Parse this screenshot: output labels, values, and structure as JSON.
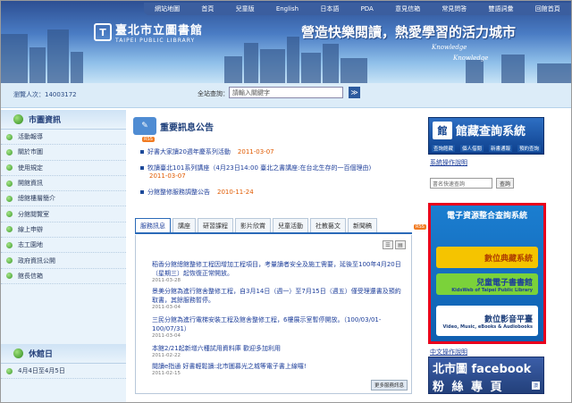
{
  "colors": {
    "header_top": "#2d4f93",
    "accent": "#1d3e9a",
    "date": "#e05a00",
    "ebox_border": "#e8001c"
  },
  "topnav": [
    "網站地圖",
    "首頁",
    "兒童版",
    "English",
    "日本語",
    "PDA",
    "意見信箱",
    "常見問答",
    "雙語詞彙",
    "回館首頁"
  ],
  "logo": {
    "title": "臺北市立圖書館",
    "subtitle": "TAIPEI PUBLIC LIBRARY",
    "mark": "T"
  },
  "slogan": "營造快樂閱讀，熱愛學習的活力城市",
  "keywords": [
    "Knowledge",
    "Knowledge"
  ],
  "infobar": {
    "visits": "瀏覽人次：14003172",
    "search_label": "全站查詢：",
    "search_placeholder": "請輸入關鍵字",
    "search_button": "≫"
  },
  "sidebar": {
    "title": "市圖資訊",
    "items": [
      "活動報導",
      "關於市圖",
      "使用規定",
      "開館資訊",
      "總館樓層簡介",
      "分館閱覽室",
      "線上申辦",
      "志工園地",
      "政府資訊公開",
      "館長信箱"
    ]
  },
  "holiday": {
    "title": "休館日",
    "items": [
      "4月4日至4月5日"
    ]
  },
  "news_section": {
    "title": "重要訊息公告",
    "icon": "news-icon",
    "rss": "RSS",
    "items": [
      {
        "text": "好書大家讀20週年慶系列活動",
        "date": "2011-03-07"
      },
      {
        "text": "牧讀臺北101系列講座（4月23日14:00 臺北之書講座:在台北生存的一百個理由)",
        "date": "2011-03-07"
      },
      {
        "text": "分館整修服務調整公告",
        "date": "2010-11-24"
      }
    ]
  },
  "tabs": [
    "服務訊息",
    "講座",
    "研習課程",
    "影片欣賞",
    "兒童活動",
    "社教藝文",
    "新聞稿"
  ],
  "rss2": "RSS",
  "posts": [
    {
      "title": "稻香分館總館整修工程因增加工程項目，考量讀者安全及施工需要，延後至100年4月20日（星期三）起恢復正常開放。",
      "date": "2011-03-28"
    },
    {
      "title": "景美分館為進行館舍整修工程，自3月14日（週一）至7月15日（週五）僅受理還書及預約取書，其餘服務暫停。",
      "date": "2011-03-04"
    },
    {
      "title": "三民分館為進行電梯安裝工程及館舍整修工程，6樓展示室暫停開放。（100/03/01-100/07/31）",
      "date": "2011-03-04"
    },
    {
      "title": "本館2/21起新增六種試用資料庫 歡迎多加利用",
      "date": "2011-02-22"
    },
    {
      "title": "閱讀e指通 好書輕鬆讀:北市圖募光之城等電子書上線囉!",
      "date": "2011-02-15"
    }
  ],
  "more_button": "更多服務訊息",
  "view_icons": [
    "☰",
    "▤"
  ],
  "right": {
    "catalog_title": "館藏查詢系統",
    "catalog_links": [
      "查詢館藏",
      "個人借閱",
      "新書通報",
      "預約查詢"
    ],
    "howto": "系統操作說明",
    "quick_placeholder": "書名快速查詢",
    "quick_button": "查詢",
    "ebox_title": "電子資源整合查詢系統",
    "ebox_items": [
      {
        "big": "數位典藏系統",
        "small": "",
        "bg": "#f5c400",
        "fg": "#b04000"
      },
      {
        "big": "兒童電子書書館",
        "small": "KidsWeb of Taipei Public Library",
        "bg": "#7bd23a",
        "fg": "#1d3e9a"
      },
      {
        "big": "數位影音平臺",
        "small": "Video, Music, eBooks & Audiobooks",
        "bg": "#ffffff",
        "fg": "#1d3e7a"
      }
    ],
    "howto2": "中文操作說明",
    "fb_line1": "北市圖 facebook",
    "fb_line2": "粉 絲 專 頁",
    "fb_like": "讚"
  }
}
